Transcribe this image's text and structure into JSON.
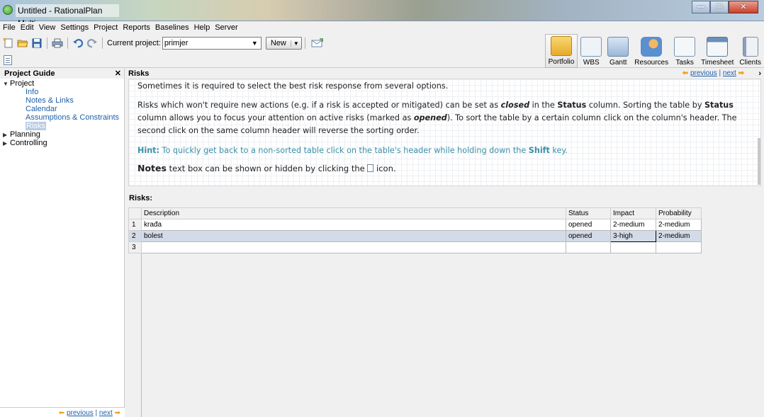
{
  "window": {
    "title": "Untitled - RationalPlan Multi"
  },
  "menu": [
    "File",
    "Edit",
    "View",
    "Settings",
    "Project",
    "Reports",
    "Baselines",
    "Help",
    "Server"
  ],
  "toolbar": {
    "current_project_label": "Current project:",
    "current_project_value": "primjer",
    "new_button": "New",
    "big_buttons": [
      "Portfolio",
      "WBS",
      "Gantt",
      "Resources",
      "Tasks",
      "Timesheet",
      "Clients"
    ]
  },
  "project_guide": {
    "title": "Project Guide",
    "tree": {
      "project": "Project",
      "project_children": [
        "Info",
        "Notes & Links",
        "Calendar",
        "Assumptions & Constraints",
        "Risks"
      ],
      "planning": "Planning",
      "controlling": "Controlling"
    },
    "footer_previous": "previous",
    "footer_next": "next"
  },
  "risks_panel": {
    "title": "Risks",
    "nav_previous": "previous",
    "nav_next": "next",
    "para1": "Sometimes it is required to select the best risk response from several options.",
    "para2": {
      "t1": "Risks which won't require new actions (e.g. if a risk is accepted or mitigated) can be set as ",
      "closed": "closed",
      "t2": " in the ",
      "status": "Status",
      "t3": " column. Sorting the table by ",
      "status2": "Status",
      "t4": " column allows you to focus your attention on active risks (marked as ",
      "opened": "opened",
      "t5": "). To sort the table by a certain column click on the column's header. The second click on the same column header will reverse the sorting order."
    },
    "hint": {
      "label": "Hint:",
      "t1": " To quickly get back to a non-sorted table click on the table's header while holding down the ",
      "shift": "Shift",
      "t2": " key."
    },
    "notes": {
      "label": "Notes",
      "t1": " text box can be shown or hidden by clicking the ",
      "t2": " icon."
    },
    "table_label": "Risks:",
    "columns": [
      "Description",
      "Status",
      "Impact",
      "Probability"
    ],
    "rows": [
      {
        "num": "1",
        "description": "krađa",
        "status": "opened",
        "impact": "2-medium",
        "probability": "2-medium"
      },
      {
        "num": "2",
        "description": "bolest",
        "status": "opened",
        "impact": "3-high",
        "probability": "2-medium"
      },
      {
        "num": "3",
        "description": "",
        "status": "",
        "impact": "",
        "probability": ""
      }
    ]
  }
}
